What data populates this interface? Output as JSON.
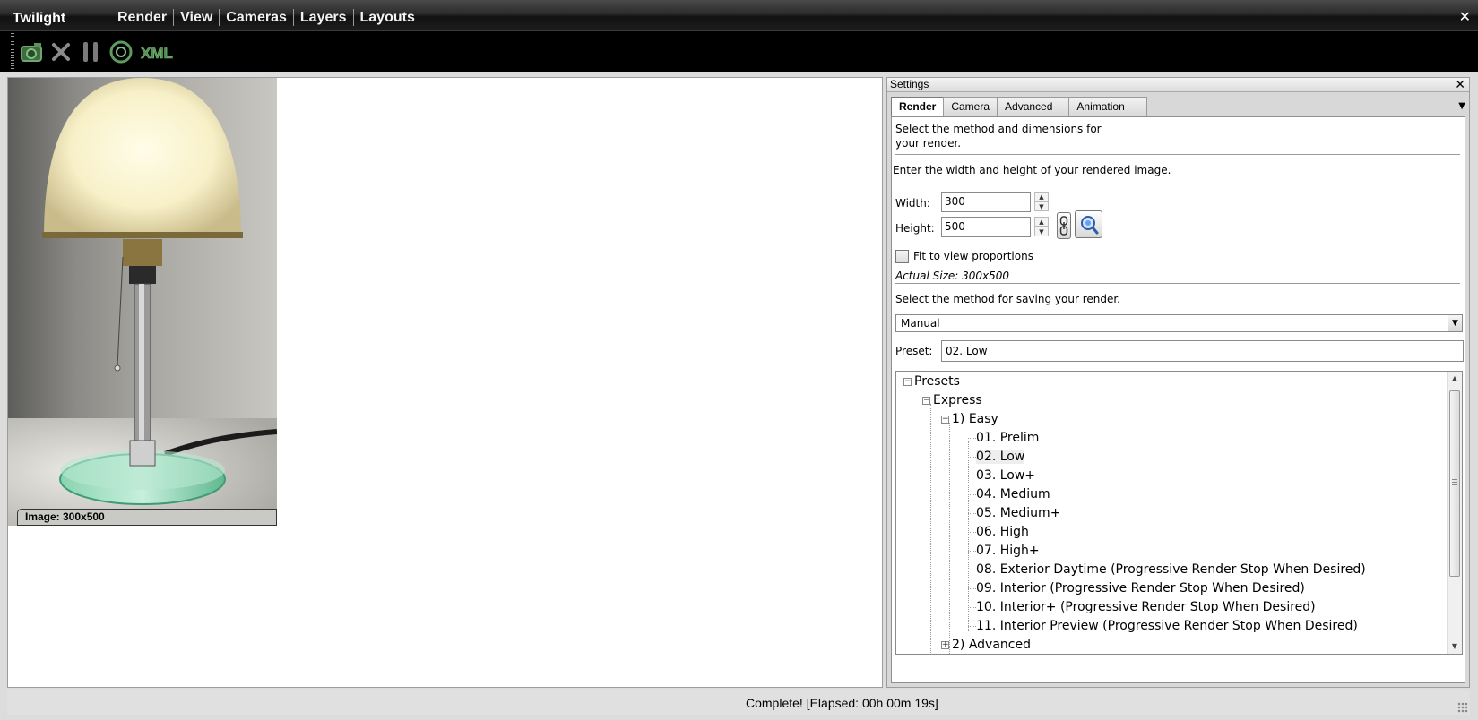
{
  "app": {
    "title": "Twilight",
    "close_glyph": "✕"
  },
  "menu": [
    {
      "label": "Render"
    },
    {
      "label": "View"
    },
    {
      "label": "Cameras"
    },
    {
      "label": "Layers"
    },
    {
      "label": "Layouts"
    }
  ],
  "toolbar": {
    "buttons": [
      {
        "icon": "camera-render-icon"
      },
      {
        "icon": "stop-icon"
      },
      {
        "icon": "pause-icon"
      },
      {
        "icon": "refresh-icon"
      },
      {
        "icon": "xml-icon",
        "text": "XML"
      }
    ]
  },
  "viewport": {
    "image_label": "Image: 300x500"
  },
  "settings": {
    "title": "Settings",
    "close_glyph": "✕",
    "tabs": [
      {
        "label": "Render",
        "active": true
      },
      {
        "label": "Camera"
      },
      {
        "label": "Advanced"
      },
      {
        "label": "Animation"
      }
    ],
    "description": "Select the method and dimensions for your render.",
    "size_instruction": "Enter the width and height of your rendered image.",
    "width_label": "Width:",
    "width_value": "300",
    "height_label": "Height:",
    "height_value": "500",
    "fit_label": "Fit to view proportions",
    "fit_checked": false,
    "actual_size": "Actual Size: 300x500",
    "save_instruction": "Select the method for saving your render.",
    "save_method": "Manual",
    "preset_label": "Preset:",
    "preset_value": "02. Low",
    "tree": {
      "root": "Presets",
      "express": "Express",
      "easy": "1) Easy",
      "items": [
        "01. Prelim",
        "02. Low",
        "03. Low+",
        "04. Medium",
        "05. Medium+",
        "06. High",
        "07. High+",
        "08. Exterior Daytime (Progressive Render Stop When Desired)",
        "09. Interior (Progressive Render Stop When Desired)",
        "10. Interior+ (Progressive Render Stop When Desired)",
        "11. Interior Preview (Progressive Render Stop When Desired)"
      ],
      "selected_index": 1,
      "advanced": "2) Advanced"
    }
  },
  "status": {
    "text": "Complete!  [Elapsed: 00h 00m 19s]"
  }
}
